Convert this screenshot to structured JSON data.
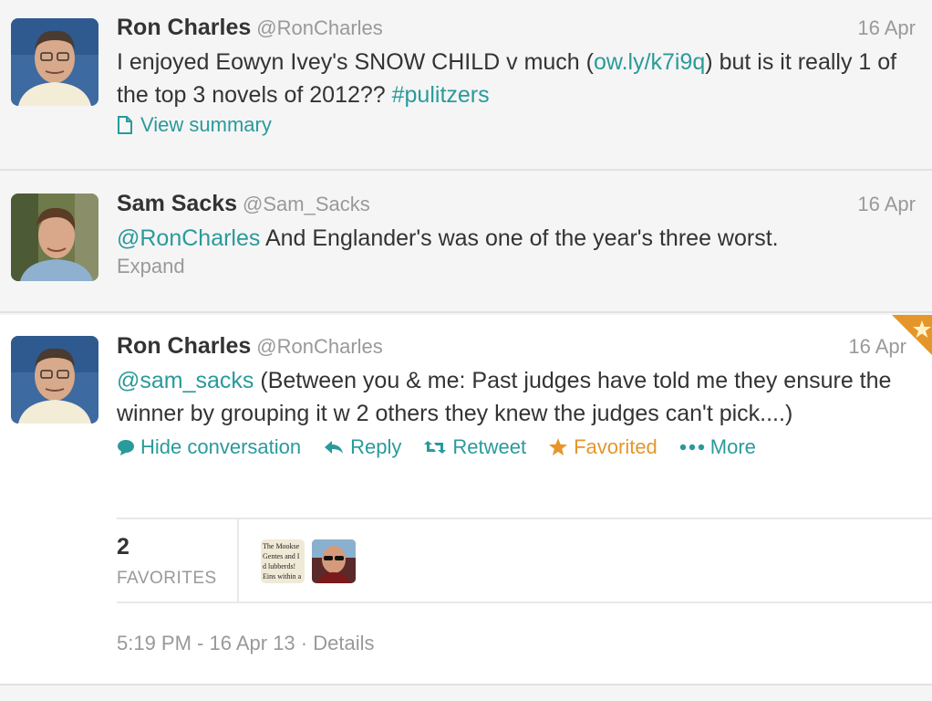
{
  "tweets": [
    {
      "fullname": "Ron Charles",
      "username": "@RonCharles",
      "time": "16 Apr",
      "text_before": "I enjoyed Eowyn Ivey's SNOW CHILD v much (",
      "link": "ow.ly/k7i9q",
      "text_middle": ") but is it really 1 of the top 3 novels of 2012?? ",
      "hashtag": "#pulitzers",
      "summary_label": "View summary"
    },
    {
      "fullname": "Sam Sacks",
      "username": "@Sam_Sacks",
      "time": "16 Apr",
      "mention": "@RonCharles",
      "text": " And Englander's was one of the year's three worst.",
      "expand_label": "Expand"
    },
    {
      "fullname": "Ron Charles",
      "username": "@RonCharles",
      "time": "16 Apr",
      "mention": "@sam_sacks",
      "text": " (Between you & me: Past judges have told me they ensure the winner by grouping it w 2 others they knew the judges can't pick....)",
      "actions": {
        "hide_conversation": "Hide conversation",
        "reply": "Reply",
        "retweet": "Retweet",
        "favorited": "Favorited",
        "more": "More"
      },
      "favorites_count": "2",
      "favorites_label": "FAVORITES",
      "favoriter_1_caption": [
        "The Mookse",
        "Gentes and I",
        "d lubberds!",
        "Eins within a"
      ],
      "timestamp": "5:19 PM - 16 Apr 13",
      "details_sep": " · ",
      "details_label": "Details"
    }
  ],
  "colors": {
    "link": "#2a9a9b",
    "favorite": "#e5962b",
    "muted": "#999999"
  }
}
